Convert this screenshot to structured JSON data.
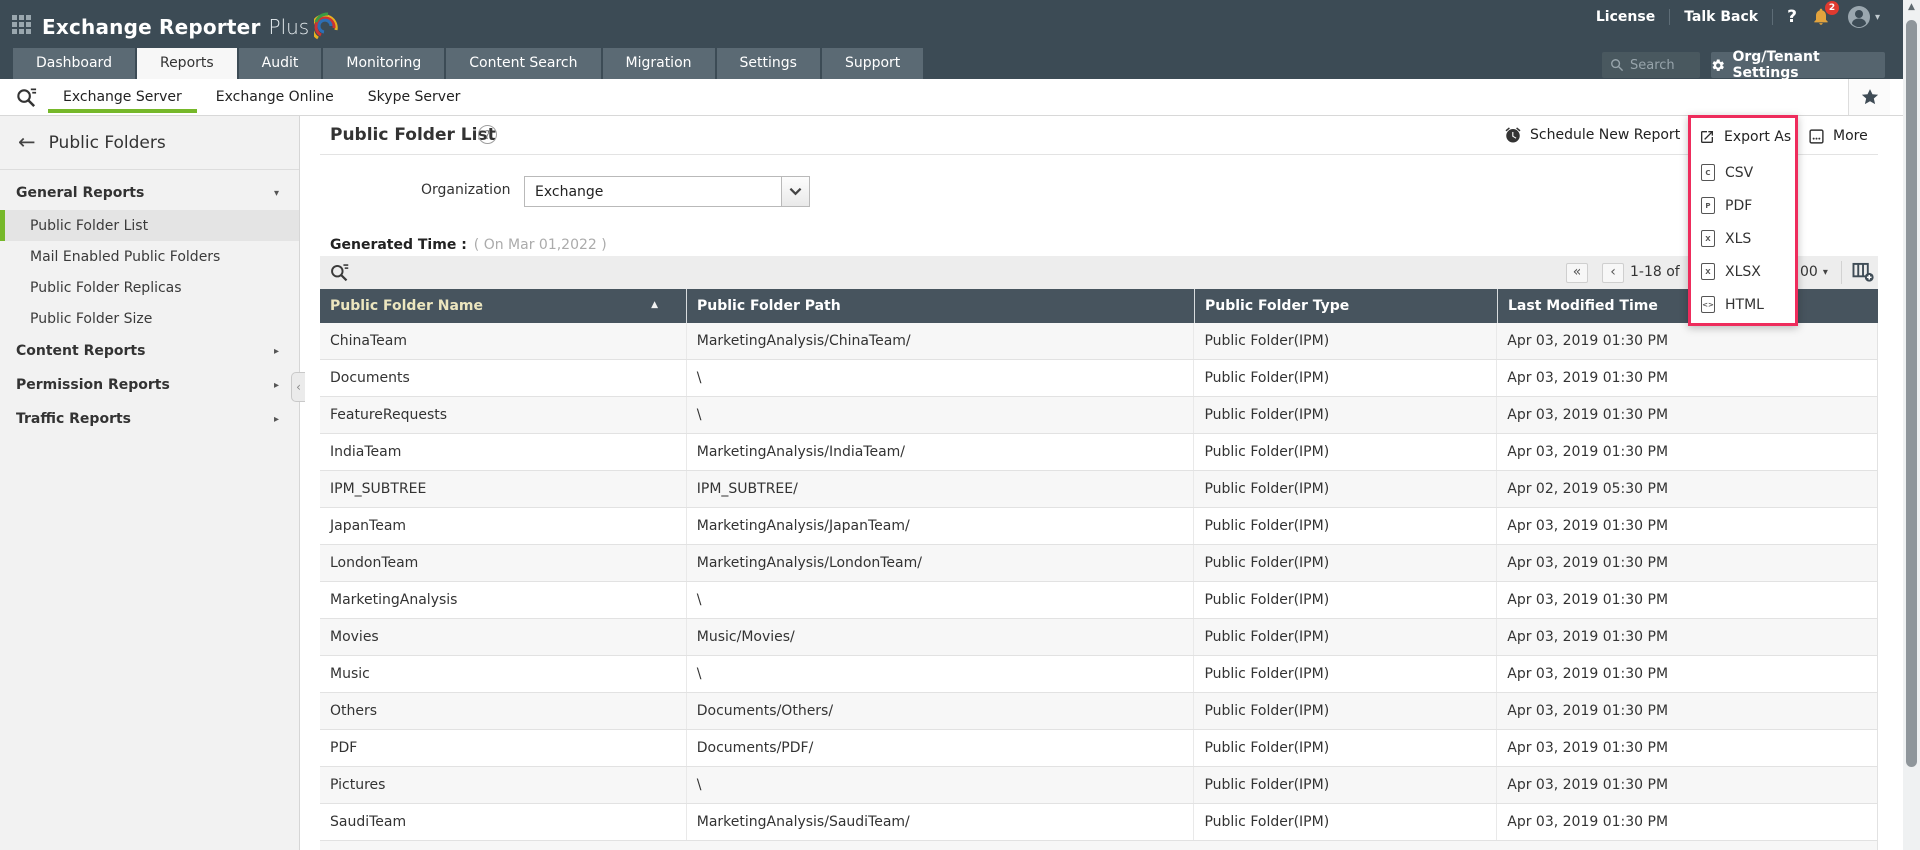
{
  "colors": {
    "accent_green": "#76b82a",
    "highlight_pink": "#ee2c5c",
    "header_slate": "#3c4b55",
    "table_header_slate": "#47545e",
    "badge_red": "#e03a2f",
    "bell_amber": "#e2a33d"
  },
  "icons": {
    "help": "?",
    "caret_down": "▾",
    "caret_right": "▸",
    "back_arrow": "←",
    "first_page": "«",
    "prev_page": "‹",
    "sort_asc": "▲",
    "scroll_up": "▲",
    "avatar_caret": "▾",
    "page_size_caret": "▾",
    "collapse": "‹",
    "title_help": "?"
  },
  "header": {
    "app_title_main": "Exchange Reporter",
    "app_title_suffix": "Plus",
    "license_label": "License",
    "talkback_label": "Talk Back",
    "notification_count": "2",
    "tabs": [
      "Dashboard",
      "Reports",
      "Audit",
      "Monitoring",
      "Content Search",
      "Migration",
      "Settings",
      "Support"
    ],
    "active_tab": "Reports",
    "search_placeholder": "Search",
    "org_settings_label": "Org/Tenant Settings"
  },
  "subnav": {
    "tabs": [
      "Exchange Server",
      "Exchange Online",
      "Skype Server"
    ],
    "active": "Exchange Server"
  },
  "sidebar": {
    "title": "Public Folders",
    "active_item": "Public Folder List",
    "sections": [
      {
        "label": "General Reports",
        "expanded": true,
        "items": [
          "Public Folder List",
          "Mail Enabled Public Folders",
          "Public Folder Replicas",
          "Public Folder Size"
        ]
      },
      {
        "label": "Content Reports",
        "expanded": false,
        "items": []
      },
      {
        "label": "Permission Reports",
        "expanded": false,
        "items": []
      },
      {
        "label": "Traffic Reports",
        "expanded": false,
        "items": []
      }
    ]
  },
  "report": {
    "title": "Public Folder List",
    "schedule_label": "Schedule New Report",
    "export_label": "Export As",
    "more_label": "More",
    "export_options": [
      {
        "label": "CSV",
        "glyph": "C"
      },
      {
        "label": "PDF",
        "glyph": "P"
      },
      {
        "label": "XLS",
        "glyph": "X"
      },
      {
        "label": "XLSX",
        "glyph": "X"
      },
      {
        "label": "HTML",
        "glyph": "<>"
      }
    ],
    "organization_label": "Organization",
    "organization_value": "Exchange",
    "generated_label": "Generated Time :",
    "generated_value": "( On Mar 01,2022 )",
    "pagination": {
      "range_text": "1-18 of",
      "page_size_text": "00"
    }
  },
  "table": {
    "columns": [
      "Public Folder Name",
      "Public Folder Path",
      "Public Folder Type",
      "Last Modified Time"
    ],
    "sorted_column": "Public Folder Name",
    "rows": [
      [
        "ChinaTeam",
        "MarketingAnalysis/ChinaTeam/",
        "Public Folder(IPM)",
        "Apr 03, 2019 01:30 PM"
      ],
      [
        "Documents",
        "\\",
        "Public Folder(IPM)",
        "Apr 03, 2019 01:30 PM"
      ],
      [
        "FeatureRequests",
        "\\",
        "Public Folder(IPM)",
        "Apr 03, 2019 01:30 PM"
      ],
      [
        "IndiaTeam",
        "MarketingAnalysis/IndiaTeam/",
        "Public Folder(IPM)",
        "Apr 03, 2019 01:30 PM"
      ],
      [
        "IPM_SUBTREE",
        "IPM_SUBTREE/",
        "Public Folder(IPM)",
        "Apr 02, 2019 05:30 PM"
      ],
      [
        "JapanTeam",
        "MarketingAnalysis/JapanTeam/",
        "Public Folder(IPM)",
        "Apr 03, 2019 01:30 PM"
      ],
      [
        "LondonTeam",
        "MarketingAnalysis/LondonTeam/",
        "Public Folder(IPM)",
        "Apr 03, 2019 01:30 PM"
      ],
      [
        "MarketingAnalysis",
        "\\",
        "Public Folder(IPM)",
        "Apr 03, 2019 01:30 PM"
      ],
      [
        "Movies",
        "Music/Movies/",
        "Public Folder(IPM)",
        "Apr 03, 2019 01:30 PM"
      ],
      [
        "Music",
        "\\",
        "Public Folder(IPM)",
        "Apr 03, 2019 01:30 PM"
      ],
      [
        "Others",
        "Documents/Others/",
        "Public Folder(IPM)",
        "Apr 03, 2019 01:30 PM"
      ],
      [
        "PDF",
        "Documents/PDF/",
        "Public Folder(IPM)",
        "Apr 03, 2019 01:30 PM"
      ],
      [
        "Pictures",
        "\\",
        "Public Folder(IPM)",
        "Apr 03, 2019 01:30 PM"
      ],
      [
        "SaudiTeam",
        "MarketingAnalysis/SaudiTeam/",
        "Public Folder(IPM)",
        "Apr 03, 2019 01:30 PM"
      ]
    ]
  }
}
